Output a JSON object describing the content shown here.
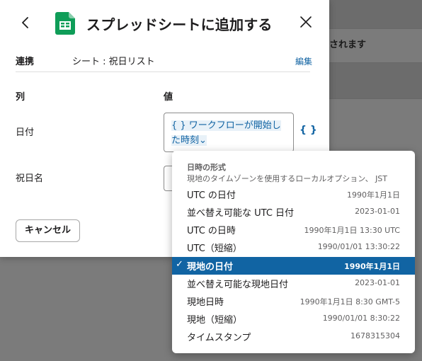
{
  "background": {
    "notice_text": "されます"
  },
  "modal": {
    "title": "スプレッドシートに追加する",
    "connection_label": "連携",
    "connection_value": "シート : 祝日リスト",
    "edit_label": "編集",
    "column_header": "列",
    "value_header": "値",
    "rows": [
      {
        "label": "日付",
        "token_text": "{ } ワークフローが開始し",
        "token_text_2": "た時刻",
        "token_chevron": "⌄"
      },
      {
        "label": "祝日名"
      }
    ],
    "var_button": "{ }",
    "cancel_label": "キャンセル"
  },
  "dropdown": {
    "heading": "日時の形式",
    "subheading": "現地のタイムゾーンを使用するローカルオプション、 JST",
    "items": [
      {
        "label": "UTC の日付",
        "example": "1990年1月1日",
        "selected": false
      },
      {
        "label": "並べ替え可能な UTC 日付",
        "example": "2023-01-01",
        "selected": false
      },
      {
        "label": "UTC の日時",
        "example": "1990年1月1日 13:30 UTC",
        "selected": false
      },
      {
        "label": "UTC（短縮）",
        "example": "1990/01/01 13:30:22",
        "selected": false
      },
      {
        "label": "現地の日付",
        "example": "1990年1月1日",
        "selected": true
      },
      {
        "label": "並べ替え可能な現地日付",
        "example": "2023-01-01",
        "selected": false
      },
      {
        "label": "現地日時",
        "example": "1990年1月1日 8:30 GMT-5",
        "selected": false
      },
      {
        "label": "現地（短縮）",
        "example": "1990/01/01 8:30:22",
        "selected": false
      },
      {
        "label": "タイムスタンプ",
        "example": "1678315304",
        "selected": false
      }
    ],
    "check_glyph": "✓"
  },
  "colors": {
    "accent": "#1264a3",
    "selected_bg": "#1164a3",
    "sheets_green": "#0f9d58"
  }
}
